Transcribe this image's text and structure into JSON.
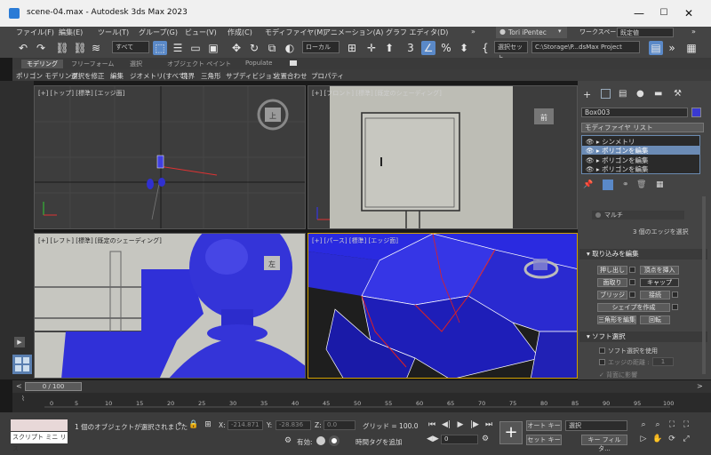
{
  "window": {
    "title": "scene-04.max - Autodesk 3ds Max 2023",
    "minimize": "—",
    "maximize": "☐",
    "close": "✕"
  },
  "menu": {
    "items": [
      "ファイル(F)",
      "編集(E)",
      "ツール(T)",
      "グループ(G)",
      "ビュー(V)",
      "作成(C)",
      "モディファイヤ(M)",
      "アニメーション(A)",
      "グラフ エディタ(D)",
      "»"
    ],
    "user": "Tori iPentec",
    "workspace_label": "ワークスペース:",
    "workspace_value": "既定値"
  },
  "toolbar": {
    "selection_filter": "すべて",
    "ref_coord": "ローカル",
    "selection_set": "選択セット",
    "project_path": "C:\\Storage\\P...dsMax Project"
  },
  "ribbon": {
    "tabs": [
      "モデリング",
      "フリーフォーム",
      "選択",
      "オブジェクト ペイント",
      "Populate"
    ],
    "items": [
      "ポリゴン モデリング",
      "選択を修正",
      "編集",
      "ジオメトリ(すべて)",
      "境界",
      "三角形",
      "サブディビジョン",
      "位置合わせ",
      "プロパティ"
    ]
  },
  "viewports": {
    "top": "[+] [トップ] [標準] [エッジ面]",
    "front": "[+] [フロント] [標準] [既定のシェーディング]",
    "left": "[+] [レフト] [標準] [既定のシェーディング]",
    "persp": "[+] [パース] [標準] [エッジ面]",
    "cube_top": "上",
    "cube_front": "前",
    "cube_left": "左"
  },
  "command_panel": {
    "object_name": "Box003",
    "modifier_list": "モディファイヤ リスト",
    "stack": [
      "シンメトリ",
      "ポリゴンを編集",
      "ポリゴンを編集",
      "ポリゴンを編集"
    ],
    "multi_label": "マルチ",
    "edge_info": "3 個のエッジを選択",
    "rollout_edit": "取り込みを編集",
    "btn_extrude": "押し出し",
    "btn_insert_vertex": "頂点を挿入",
    "btn_chamfer": "面取り",
    "btn_weld": "キャップ",
    "btn_bridge": "ブリッジ",
    "btn_connect": "接続",
    "btn_create_shape": "シェイプを作成",
    "btn_tri_edit": "三角形を編集",
    "btn_rotate": "回転",
    "rollout_soft": "ソフト選択",
    "soft_use": "ソフト選択を使用",
    "edge_distance": "エッジの距離 :",
    "edge_distance_val": "1",
    "affect_back": "背面に影響"
  },
  "timeline": {
    "frame": "0 / 100",
    "ticks": [
      "0",
      "5",
      "10",
      "15",
      "20",
      "25",
      "30",
      "35",
      "40",
      "45",
      "50",
      "55",
      "60",
      "65",
      "70",
      "75",
      "80",
      "85",
      "90",
      "95",
      "100"
    ]
  },
  "status": {
    "script_mini": "スクリプト ミニ リス",
    "selected": "1 個のオブジェクトが選択されました",
    "x_label": "X:",
    "x_val": "-214.871",
    "y_label": "Y:",
    "y_val": "-28.836",
    "z_label": "Z:",
    "z_val": "0.0",
    "grid": "グリッド = 100.0",
    "enabled": "有効:",
    "add_time_tag": "時間タグを追加",
    "frame_field": "0",
    "auto_key": "オート キー",
    "selection": "選択",
    "set_key": "セット キー",
    "key_filter": "キー フィルタ..."
  }
}
